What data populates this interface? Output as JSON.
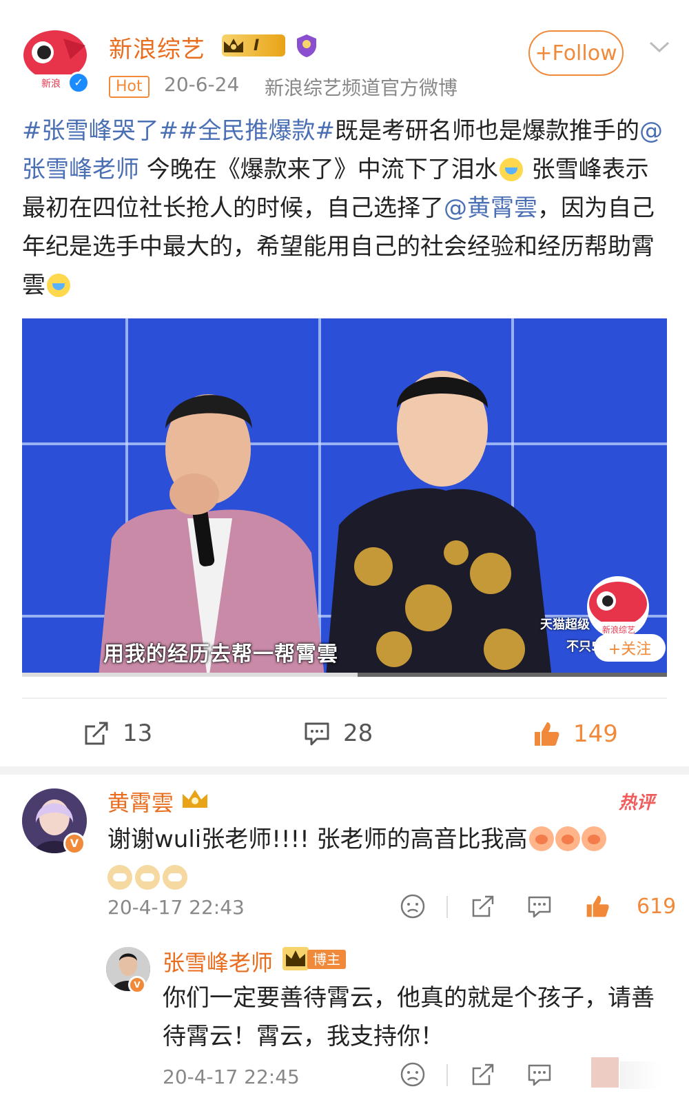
{
  "post": {
    "author": "新浪综艺",
    "level_badge": "I",
    "hot_label": "Hot",
    "date": "20-6-24",
    "source": "新浪综艺频道官方微博",
    "follow_label": "+Follow",
    "text": {
      "tag1": "#张雪峰哭了#",
      "tag2": "#全民推爆款#",
      "seg1": "既是考研名师也是爆款推手的",
      "mention1": "@张雪峰老师",
      "seg2": " 今晚在《爆款来了》中流下了泪水",
      "seg3": " 张雪峰表示最初在四位社长抢人的时候，自己选择了",
      "mention2": "@黄霄雲",
      "seg4": "，因为自己年纪是选手中最大的，希望能用自己的社会经验和经历帮助霄雲"
    },
    "video": {
      "subtitle": "用我的经历去帮一帮霄雲",
      "watermark_line1": "天猫超级",
      "watermark_line2": "不只5",
      "watermark_follow": "+关注",
      "watermark_logo_text": "新浪综艺",
      "progress": 0.52
    },
    "actions": {
      "reposts": "13",
      "comments": "28",
      "likes": "149"
    }
  },
  "comment": {
    "author": "黄霄雲",
    "hot_label": "热评",
    "text": "谢谢wuli张老师!!!! 张老师的高音比我高",
    "time": "20-4-17 22:43",
    "likes": "619",
    "reply": {
      "author": "张雪峰老师",
      "badge": "博主",
      "text": "你们一定要善待霄云，他真的就是个孩子，请善待霄云！霄云，我支持你！",
      "time": "20-4-17 22:45"
    }
  },
  "colors": {
    "accent": "#f0893a",
    "name": "#e86d1f",
    "link": "#4a6fb5",
    "video_bg": "#2b4fd6"
  }
}
